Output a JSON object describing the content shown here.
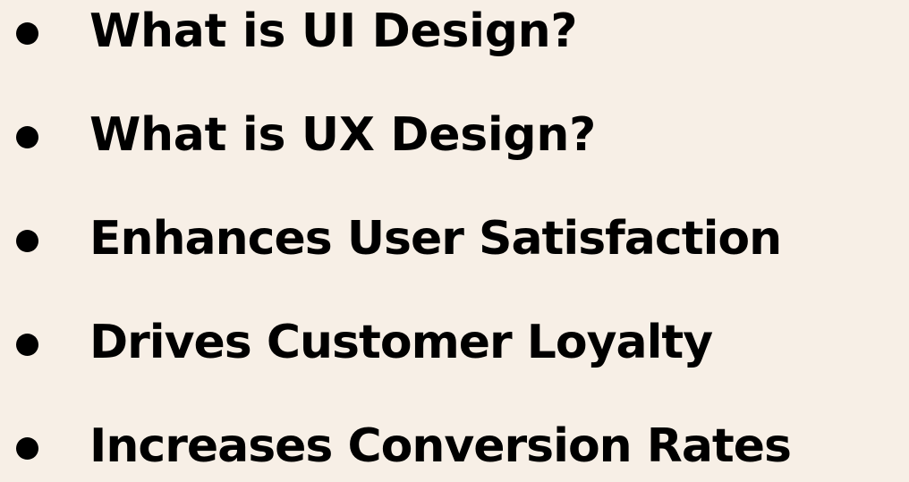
{
  "page": {
    "background_color": "#F7EFE6",
    "text_color": "#000000"
  },
  "bullets": [
    {
      "label": "What is UI Design?"
    },
    {
      "label": "What is UX Design?"
    },
    {
      "label": "Enhances User Satisfaction"
    },
    {
      "label": "Drives Customer Loyalty"
    },
    {
      "label": "Increases Conversion Rates"
    }
  ]
}
